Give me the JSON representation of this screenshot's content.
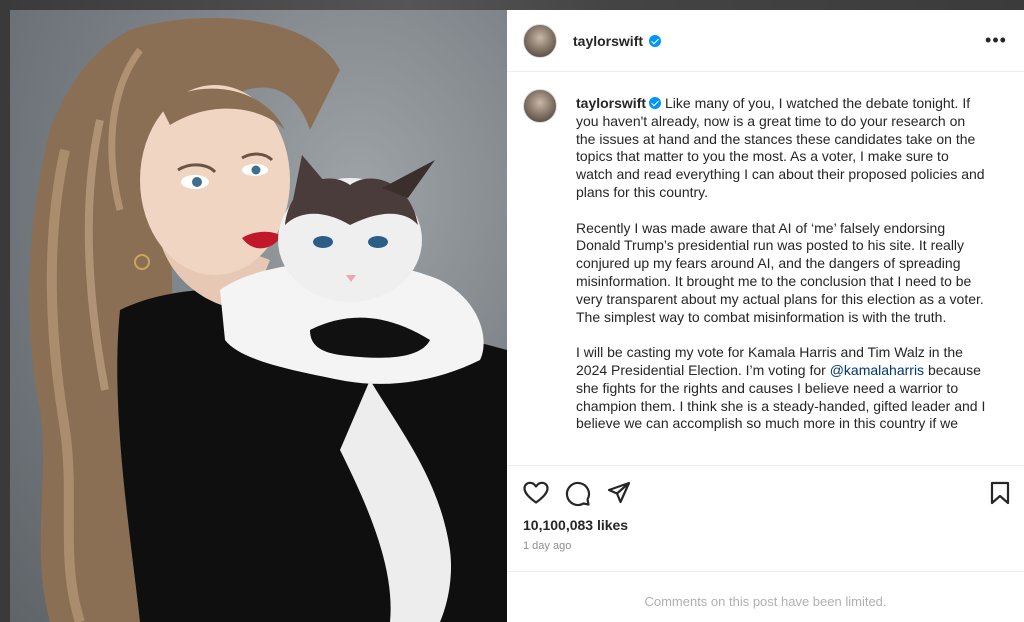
{
  "post": {
    "username": "taylorswift",
    "verified": true,
    "more_icon": "more-horizontal-icon",
    "caption": {
      "username": "taylorswift",
      "p1": "Like many of you, I watched the debate tonight. If you haven't already, now is a great time to do your research on the issues at hand and the stances these candidates take on the topics that matter to you the most. As a voter, I make sure to watch and read everything I can about their proposed policies and plans for this country.",
      "p2": "Recently I was made aware that AI of ‘me’ falsely endorsing Donald Trump’s presidential run was posted to his site. It really conjured up my fears around AI, and the dangers of spreading misinformation. It brought me to the conclusion that I need to be very transparent about my actual plans for this election as a voter. The simplest way to combat misinformation is with the truth.",
      "p3_before": "I will be casting my vote for Kamala Harris and Tim Walz in the 2024 Presidential Election. I’m voting for ",
      "p3_mention": "@kamalaharris",
      "p3_after": " because she fights for the rights and causes I believe need a warrior to champion them. I think she is a steady-handed, gifted leader and I believe we can accomplish so much more in this country if we"
    },
    "actions": {
      "like_icon": "heart-icon",
      "comment_icon": "comment-icon",
      "share_icon": "send-icon",
      "save_icon": "bookmark-icon"
    },
    "likes": "10,100,083 likes",
    "time_ago": "1 day ago",
    "comments_notice": "Comments on this post have been limited.",
    "colors": {
      "verified_blue": "#0095f6",
      "mention_link": "#00376b",
      "muted_text": "#8e8e8e"
    }
  }
}
